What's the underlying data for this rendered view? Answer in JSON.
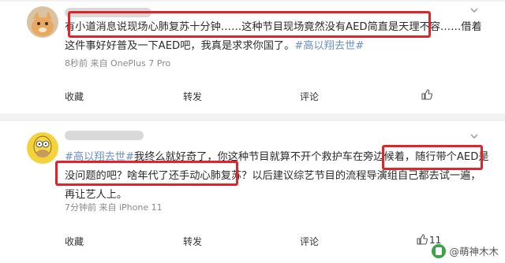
{
  "posts": [
    {
      "text_parts": [
        "有小道消息说现场心肺复苏十分钟……这种节目现场竟然没有AED简直是天理不容……借着这件事好好普及一下AED吧，我真是求求你国了。"
      ],
      "tag": "#高以翔去世#",
      "meta": "8秒前  来自 OnePlus 7 Pro",
      "actions": {
        "collect": "收藏",
        "repost": "转发",
        "comment": "评论"
      }
    },
    {
      "tag": "#高以翔去世#",
      "text": "我终么就好奇了，你这种节目就算不开个救护车在旁边候着，随行带个AED是没问题的吧？啥年代了还手动心肺复苏？以后建议综艺节目的流程导演组自己都去试一遍，再让艺人上。",
      "meta": "7分钟前  来自 iPhone 11",
      "actions": {
        "collect": "收藏",
        "repost": "转发",
        "comment": "评论"
      },
      "like_count": "11"
    }
  ],
  "watermark": "@萌神木木",
  "colors": {
    "highlight": "#e0252a",
    "tag": "#6b8fc7",
    "separator": "#f2f2f2"
  }
}
